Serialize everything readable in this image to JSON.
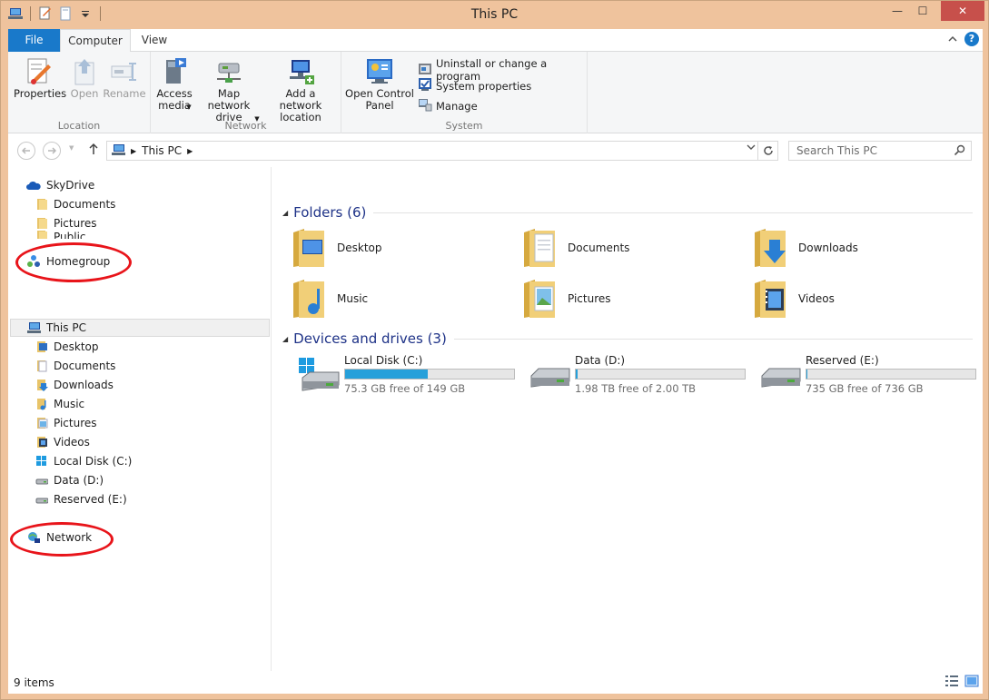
{
  "window": {
    "title": "This PC",
    "controls": {
      "minimize": "—",
      "maximize": "☐",
      "close": "✕"
    }
  },
  "ribbon": {
    "tabs": {
      "file": "File",
      "computer": "Computer",
      "view": "View"
    },
    "help": "?",
    "groups": {
      "location": {
        "label": "Location",
        "properties": "Properties",
        "open": "Open",
        "rename": "Rename"
      },
      "network": {
        "label": "Network",
        "access_media": "Access media",
        "map_network_drive": "Map network drive",
        "add_network_location": "Add a network location"
      },
      "open_control_panel": "Open Control Panel",
      "system": {
        "label": "System",
        "uninstall": "Uninstall or change a program",
        "system_properties": "System properties",
        "manage": "Manage"
      }
    }
  },
  "address": {
    "path": "This PC",
    "search_placeholder": "Search This PC"
  },
  "navigation": {
    "skydrive": "SkyDrive",
    "skydrive_items": [
      "Documents",
      "Pictures",
      "Public"
    ],
    "homegroup": "Homegroup",
    "this_pc": "This PC",
    "this_pc_items": [
      "Desktop",
      "Documents",
      "Downloads",
      "Music",
      "Pictures",
      "Videos",
      "Local Disk (C:)",
      "Data (D:)",
      "Reserved (E:)"
    ],
    "network": "Network"
  },
  "content": {
    "folders_heading": "Folders (6)",
    "folders": [
      "Desktop",
      "Documents",
      "Downloads",
      "Music",
      "Pictures",
      "Videos"
    ],
    "drives_heading": "Devices and drives (3)",
    "drives": [
      {
        "name": "Local Disk (C:)",
        "free": "75.3 GB free of 149 GB",
        "used_fraction": 0.49
      },
      {
        "name": "Data (D:)",
        "free": "1.98 TB free of 2.00 TB",
        "used_fraction": 0.01
      },
      {
        "name": "Reserved (E:)",
        "free": "735 GB free of 736 GB",
        "used_fraction": 0.001
      }
    ]
  },
  "status": {
    "items": "9 items"
  },
  "colors": {
    "accent": "#1979ca",
    "frame": "#efc39d",
    "annotation": "#e8141a",
    "drive_bar": "#26a0da",
    "heading": "#1e3287"
  }
}
